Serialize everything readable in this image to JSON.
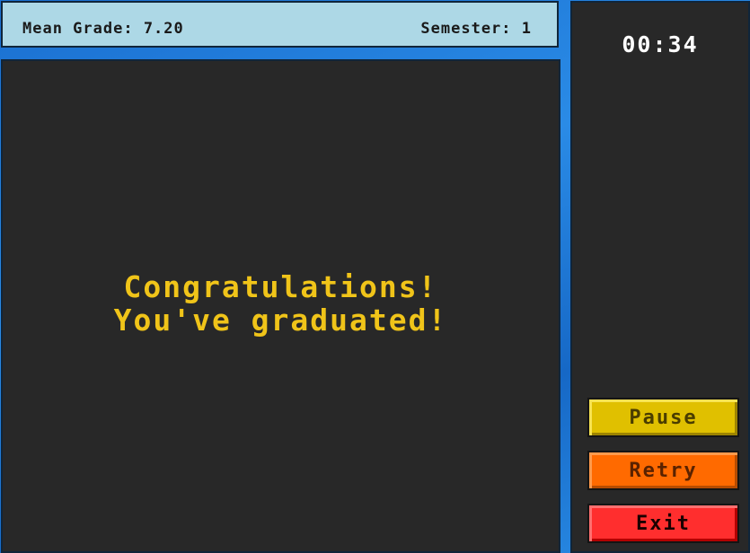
{
  "hud": {
    "mean_grade": "Mean Grade: 7.20",
    "semester": "Semester: 1"
  },
  "message": {
    "line1": "Congratulations!",
    "line2": "You've graduated!"
  },
  "timer": "00:34",
  "buttons": {
    "pause": "Pause",
    "retry": "Retry",
    "exit": "Exit"
  },
  "colors": {
    "hud_background": "#add8e6",
    "game_background": "#282828",
    "message_text": "#f0c419",
    "pause_button": "#e0c000",
    "retry_button": "#ff6a00",
    "exit_button": "#ff2e2e"
  }
}
